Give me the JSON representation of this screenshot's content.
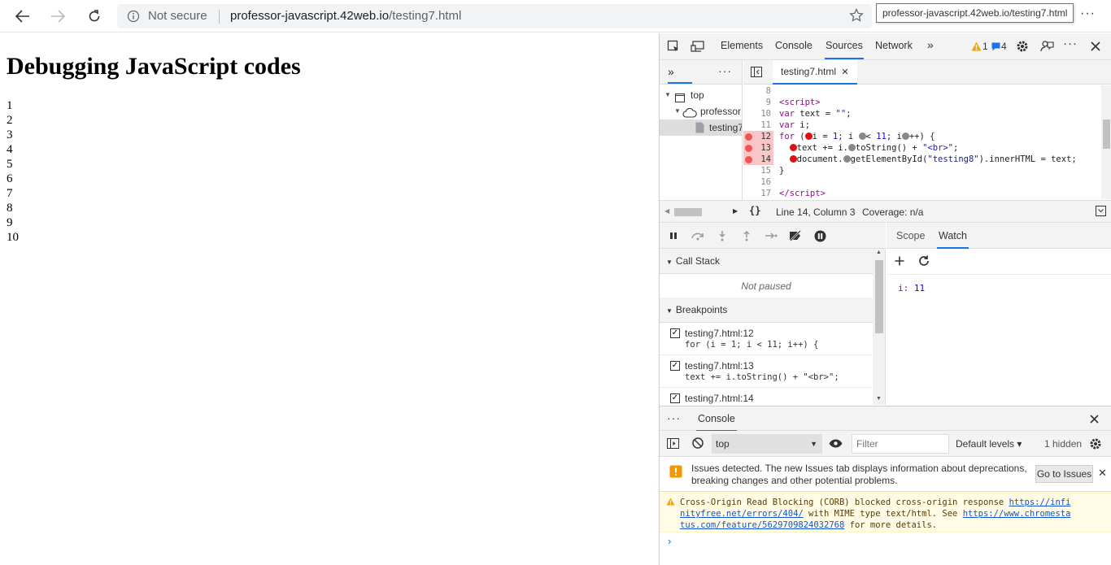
{
  "browser": {
    "security_label": "Not secure",
    "url_host": "professor-javascript.42web.io",
    "url_path": "/testing7.html",
    "tooltip": "professor-javascript.42web.io/testing7.html",
    "more_label": "···"
  },
  "page": {
    "heading": "Debugging JavaScript codes",
    "output_lines": [
      "1",
      "2",
      "3",
      "4",
      "5",
      "6",
      "7",
      "8",
      "9",
      "10"
    ]
  },
  "devtools": {
    "tabs": [
      "Elements",
      "Console",
      "Sources",
      "Network"
    ],
    "active_tab": "Sources",
    "warning_count": "1",
    "message_count": "4",
    "navigator": {
      "items": [
        "top",
        "professor",
        "testing7.html"
      ]
    },
    "editor": {
      "file_tab": "testing7.html",
      "status_position": "Line 14, Column 3",
      "status_coverage": "Coverage: n/a",
      "line_numbers": [
        "8",
        "9",
        "10",
        "11",
        "12",
        "13",
        "14",
        "15",
        "16",
        "17"
      ],
      "breakpoint_lines": [
        "12",
        "13",
        "14"
      ]
    },
    "debugger": {
      "call_stack_label": "Call Stack",
      "not_paused": "Not paused",
      "breakpoints_label": "Breakpoints",
      "breakpoints": [
        {
          "file": "testing7.html:12",
          "code": "for (i = 1; i < 11; i++) {"
        },
        {
          "file": "testing7.html:13",
          "code": "text += i.toString() + \"<br>\";"
        },
        {
          "file": "testing7.html:14",
          "code": ""
        }
      ],
      "side_tabs": [
        "Scope",
        "Watch"
      ],
      "active_side_tab": "Watch",
      "watch": [
        {
          "name": "i",
          "value": "11"
        }
      ]
    },
    "console": {
      "drawer_tab": "Console",
      "context": "top",
      "filter_placeholder": "Filter",
      "levels": "Default levels ▾",
      "hidden": "1 hidden",
      "issues_text": "Issues detected. The new Issues tab displays information about deprecations, breaking changes and other potential problems.",
      "goto_issues": "Go to Issues",
      "warning_pre": "Cross-Origin Read Blocking (CORB) blocked cross-origin response ",
      "warning_link1": "https://infi\nnityfree.net/errors/404/",
      "warning_mid": " with MIME type text/html. See ",
      "warning_link2": "https://www.chromesta\ntus.com/feature/5629709824032768",
      "warning_post": " for more details."
    }
  },
  "colors": {
    "accent": "#1a73e8",
    "breakpoint": "#e55555",
    "warning_bg": "#fffbe5"
  }
}
